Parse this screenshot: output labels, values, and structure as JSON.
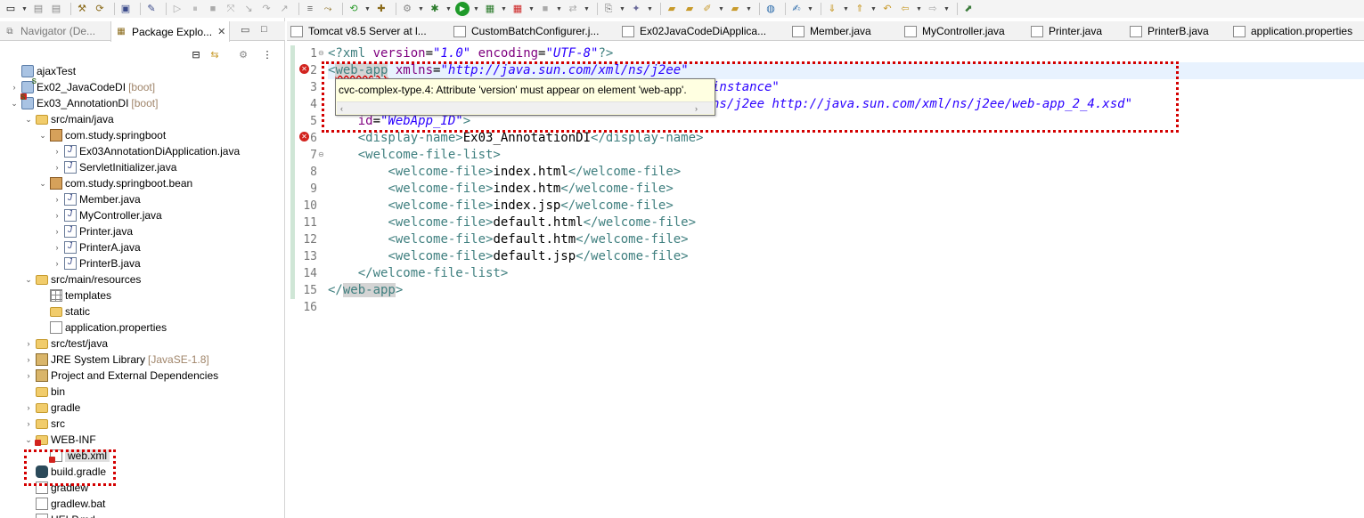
{
  "toolbar": {
    "icons": [
      "new-icon",
      "save-icon",
      "save-all-icon",
      "build-icon",
      "refresh-icon",
      "terminal-icon",
      "pin-icon",
      "debug-icon",
      "run-icon",
      "coverage-icon",
      "server-icon",
      "search-icon"
    ]
  },
  "left_panel": {
    "tabs": {
      "navigator": "Navigator (De...",
      "package_explorer": "Package Explo..."
    },
    "tree": [
      {
        "label": "ajaxTest",
        "deco": "",
        "icon": "project-icon",
        "indent": 0,
        "expander": ""
      },
      {
        "label": "Ex02_JavaCodeDI",
        "deco": "[boot]",
        "icon": "boot-project-icon",
        "indent": 0,
        "expander": "›"
      },
      {
        "label": "Ex03_AnnotationDI",
        "deco": "[boot]",
        "icon": "boot-project-error-icon",
        "indent": 0,
        "expander": "⌄"
      },
      {
        "label": "src/main/java",
        "deco": "",
        "icon": "source-folder-icon",
        "indent": 1,
        "expander": "⌄"
      },
      {
        "label": "com.study.springboot",
        "deco": "",
        "icon": "package-icon",
        "indent": 2,
        "expander": "⌄"
      },
      {
        "label": "Ex03AnnotationDiApplication.java",
        "deco": "",
        "icon": "java-file-icon",
        "indent": 3,
        "expander": "›"
      },
      {
        "label": "ServletInitializer.java",
        "deco": "",
        "icon": "java-file-icon",
        "indent": 3,
        "expander": "›"
      },
      {
        "label": "com.study.springboot.bean",
        "deco": "",
        "icon": "package-icon",
        "indent": 2,
        "expander": "⌄"
      },
      {
        "label": "Member.java",
        "deco": "",
        "icon": "java-file-icon",
        "indent": 3,
        "expander": "›"
      },
      {
        "label": "MyController.java",
        "deco": "",
        "icon": "java-file-icon",
        "indent": 3,
        "expander": "›"
      },
      {
        "label": "Printer.java",
        "deco": "",
        "icon": "java-interface-icon",
        "indent": 3,
        "expander": "›"
      },
      {
        "label": "PrinterA.java",
        "deco": "",
        "icon": "java-file-icon",
        "indent": 3,
        "expander": "›"
      },
      {
        "label": "PrinterB.java",
        "deco": "",
        "icon": "java-file-icon",
        "indent": 3,
        "expander": "›"
      },
      {
        "label": "src/main/resources",
        "deco": "",
        "icon": "source-folder-icon",
        "indent": 1,
        "expander": "⌄"
      },
      {
        "label": "templates",
        "deco": "",
        "icon": "grid-folder-icon",
        "indent": 2,
        "expander": ""
      },
      {
        "label": "static",
        "deco": "",
        "icon": "folder-icon",
        "indent": 2,
        "expander": ""
      },
      {
        "label": "application.properties",
        "deco": "",
        "icon": "properties-file-icon",
        "indent": 2,
        "expander": ""
      },
      {
        "label": "src/test/java",
        "deco": "",
        "icon": "source-folder-icon",
        "indent": 1,
        "expander": "›"
      },
      {
        "label": "JRE System Library",
        "deco": "[JavaSE-1.8]",
        "icon": "library-icon",
        "indent": 1,
        "expander": "›"
      },
      {
        "label": "Project and External Dependencies",
        "deco": "",
        "icon": "library-icon",
        "indent": 1,
        "expander": "›"
      },
      {
        "label": "bin",
        "deco": "",
        "icon": "folder-icon",
        "indent": 1,
        "expander": ""
      },
      {
        "label": "gradle",
        "deco": "",
        "icon": "folder-icon",
        "indent": 1,
        "expander": "›"
      },
      {
        "label": "src",
        "deco": "",
        "icon": "folder-icon",
        "indent": 1,
        "expander": "›"
      },
      {
        "label": "WEB-INF",
        "deco": "",
        "icon": "folder-error-icon",
        "indent": 1,
        "expander": "⌄"
      },
      {
        "label": "web.xml",
        "deco": "",
        "icon": "xml-file-error-icon",
        "indent": 2,
        "expander": "",
        "selected": true
      },
      {
        "label": "build.gradle",
        "deco": "",
        "icon": "gradle-icon",
        "indent": 1,
        "expander": ""
      },
      {
        "label": "gradlew",
        "deco": "",
        "icon": "file-icon",
        "indent": 1,
        "expander": ""
      },
      {
        "label": "gradlew.bat",
        "deco": "",
        "icon": "file-icon",
        "indent": 1,
        "expander": ""
      },
      {
        "label": "HELP.md",
        "deco": "",
        "icon": "file-icon",
        "indent": 1,
        "expander": ""
      }
    ]
  },
  "editor": {
    "tabs": [
      "Tomcat v8.5 Server at l...",
      "CustomBatchConfigurer.j...",
      "Ex02JavaCodeDiApplica...",
      "Member.java",
      "MyController.java",
      "Printer.java",
      "PrinterB.java",
      "application.properties"
    ],
    "line_numbers": [
      "1",
      "2",
      "3",
      "4",
      "5",
      "6",
      "7",
      "8",
      "9",
      "10",
      "11",
      "12",
      "13",
      "14",
      "15",
      "16"
    ],
    "code": {
      "l1_pi_open": "<?xml ",
      "l1_a1": "version",
      "l1_eq1": "=",
      "l1_v1": "\"1.0\"",
      "l1_a2": " encoding",
      "l1_eq2": "=",
      "l1_v2": "\"UTF-8\"",
      "l1_pi_close": "?>",
      "l2_lt": "<",
      "l2_tag": "web-app",
      "l2_att": " xmlns",
      "l2_eq": "=",
      "l2_val": "\"http://java.sun.com/xml/ns/j2ee\"",
      "l3_val": "instance\"",
      "l4_val": "ns/j2ee http://java.sun.com/xml/ns/j2ee/web-app_2_4.xsd\"",
      "l5_att": "id",
      "l5_eq": "=",
      "l5_val": "\"WebApp_ID\"",
      "l5_close": ">",
      "l6_open": "<display-name>",
      "l6_text": "Ex03_AnnotationDI",
      "l6_close": "</display-name>",
      "l7": "<welcome-file-list>",
      "wf_open": "<welcome-file>",
      "wf_close": "</welcome-file>",
      "wf1": "index.html",
      "wf2": "index.htm",
      "wf3": "index.jsp",
      "wf4": "default.html",
      "wf5": "default.htm",
      "wf6": "default.jsp",
      "l14": "</welcome-file-list>",
      "l15_open": "</",
      "l15_tag": "web-app",
      "l15_close": ">"
    },
    "tooltip": "cvc-complex-type.4: Attribute 'version' must appear on element 'web-app'."
  },
  "colors": {
    "error": "#d2231e",
    "highlight_box": "#d40000",
    "tag": "#3f7f7f",
    "attribute": "#7f007f",
    "value": "#2a00ff"
  }
}
